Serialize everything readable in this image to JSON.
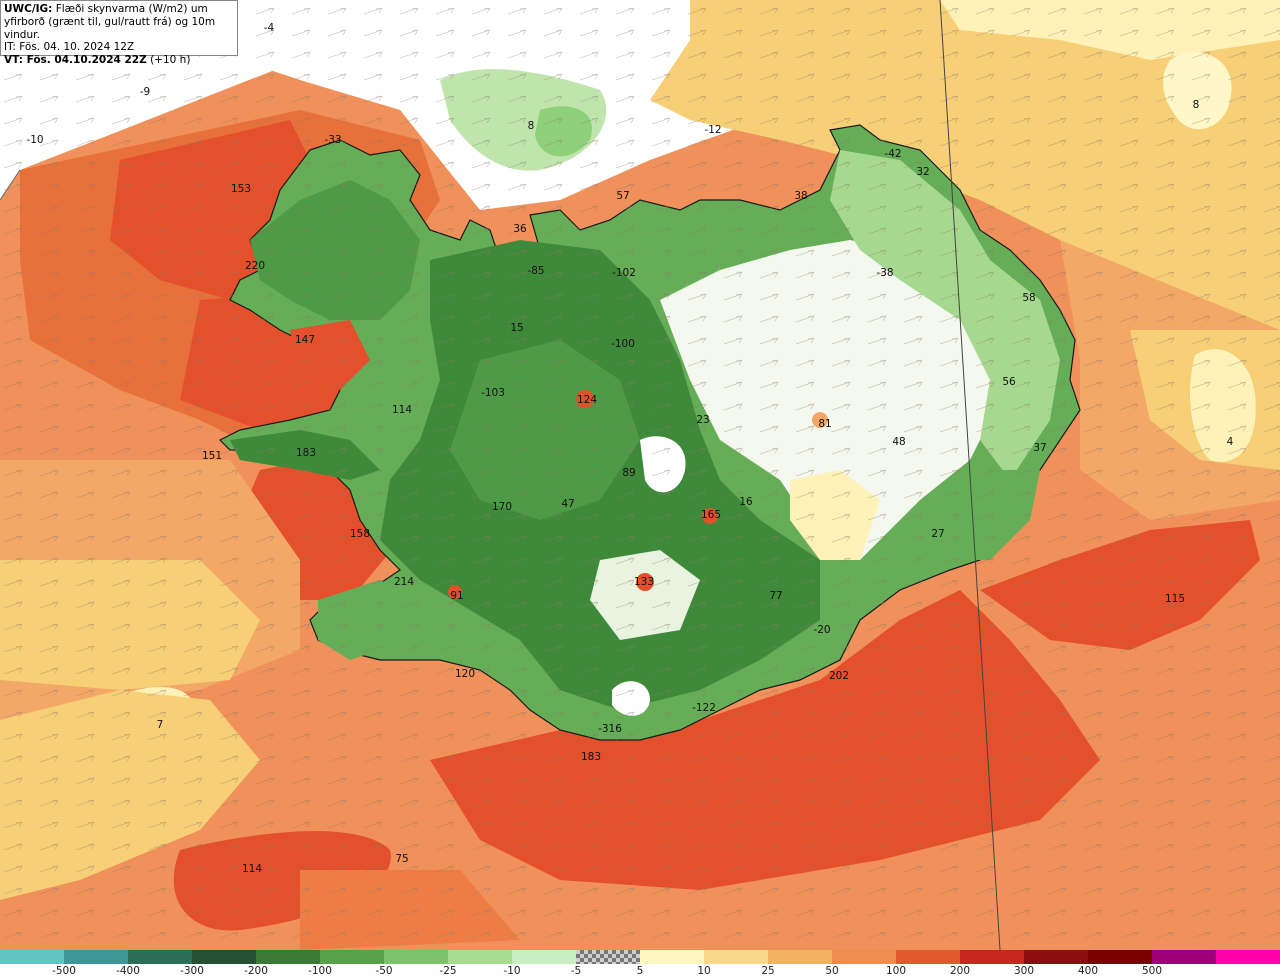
{
  "header": {
    "line1_bold": "UWC/IG:",
    "line1_rest": " Flæði skynvarma (W/m2) um",
    "line2": "yfirborð (grænt til, gul/rautt frá) og 10m vindur.",
    "line3": "IT: Fös. 04. 10. 2024 12Z",
    "line4_bold": "VT: Fös. 04.10.2024 22Z",
    "line4_rest": " (+10 h)"
  },
  "colors": {
    "land_green_dark": "#3f8a3a",
    "land_green_mid": "#65ad57",
    "land_green_light": "#a6d98f",
    "near_zero": "#ffffff",
    "pale_yellow": "#fff2b8",
    "yellow": "#f7cf77",
    "light_orange": "#f3a867",
    "orange": "#ed7d44",
    "red_orange": "#e54e29",
    "coastline": "#1a1a1a"
  },
  "values": [
    {
      "id": "v1",
      "text": "-4"
    },
    {
      "id": "v2",
      "text": "-9"
    },
    {
      "id": "v3",
      "text": "-10"
    },
    {
      "id": "v4",
      "text": "8"
    },
    {
      "id": "v5",
      "text": "-12"
    },
    {
      "id": "v6",
      "text": "8"
    },
    {
      "id": "v7",
      "text": "-33"
    },
    {
      "id": "v8",
      "text": "153"
    },
    {
      "id": "v9",
      "text": "57"
    },
    {
      "id": "v10",
      "text": "38"
    },
    {
      "id": "v11",
      "text": "-42"
    },
    {
      "id": "v12",
      "text": "32"
    },
    {
      "id": "v13",
      "text": "36"
    },
    {
      "id": "v14",
      "text": "-85"
    },
    {
      "id": "v15",
      "text": "-102"
    },
    {
      "id": "v16",
      "text": "-38"
    },
    {
      "id": "v17",
      "text": "220"
    },
    {
      "id": "v18",
      "text": "58"
    },
    {
      "id": "v19",
      "text": "15"
    },
    {
      "id": "v20",
      "text": "147"
    },
    {
      "id": "v21",
      "text": "-100"
    },
    {
      "id": "v22",
      "text": "56"
    },
    {
      "id": "v23",
      "text": "-103"
    },
    {
      "id": "v24",
      "text": "124"
    },
    {
      "id": "v25",
      "text": "114"
    },
    {
      "id": "v26",
      "text": "23"
    },
    {
      "id": "v27",
      "text": "81"
    },
    {
      "id": "v28",
      "text": "48"
    },
    {
      "id": "v29",
      "text": "4"
    },
    {
      "id": "v30",
      "text": "37"
    },
    {
      "id": "v31",
      "text": "151"
    },
    {
      "id": "v32",
      "text": "183"
    },
    {
      "id": "v33",
      "text": "89"
    },
    {
      "id": "v34",
      "text": "170"
    },
    {
      "id": "v35",
      "text": "47"
    },
    {
      "id": "v36",
      "text": "165"
    },
    {
      "id": "v37",
      "text": "16"
    },
    {
      "id": "v38",
      "text": "158"
    },
    {
      "id": "v39",
      "text": "27"
    },
    {
      "id": "v40",
      "text": "214"
    },
    {
      "id": "v41",
      "text": "133"
    },
    {
      "id": "v42",
      "text": "91"
    },
    {
      "id": "v43",
      "text": "77"
    },
    {
      "id": "v44",
      "text": "115"
    },
    {
      "id": "v45",
      "text": "-20"
    },
    {
      "id": "v46",
      "text": "120"
    },
    {
      "id": "v47",
      "text": "202"
    },
    {
      "id": "v48",
      "text": "7"
    },
    {
      "id": "v49",
      "text": "-122"
    },
    {
      "id": "v50",
      "text": "-316"
    },
    {
      "id": "v51",
      "text": "183"
    },
    {
      "id": "v52",
      "text": "75"
    },
    {
      "id": "v53",
      "text": "114"
    }
  ],
  "legend": {
    "colors": [
      "#62c4c4",
      "#3f9696",
      "#2d6e58",
      "#235033",
      "#3a7a35",
      "#58a04a",
      "#7cc26a",
      "#a5dc8f",
      "#c9eec0",
      "checker",
      "#fff7c0",
      "#f9d98a",
      "#f3b164",
      "#ec8d4f",
      "#e05a2e",
      "#c8261e",
      "#8b0d0d",
      "#7a0000",
      "#a0007a",
      "#ff00aa"
    ],
    "labels": [
      "-500",
      "-400",
      "-300",
      "-200",
      "-100",
      "-50",
      "-25",
      "-10",
      "-5",
      "5",
      "10",
      "25",
      "50",
      "100",
      "200",
      "300",
      "400",
      "500"
    ]
  }
}
